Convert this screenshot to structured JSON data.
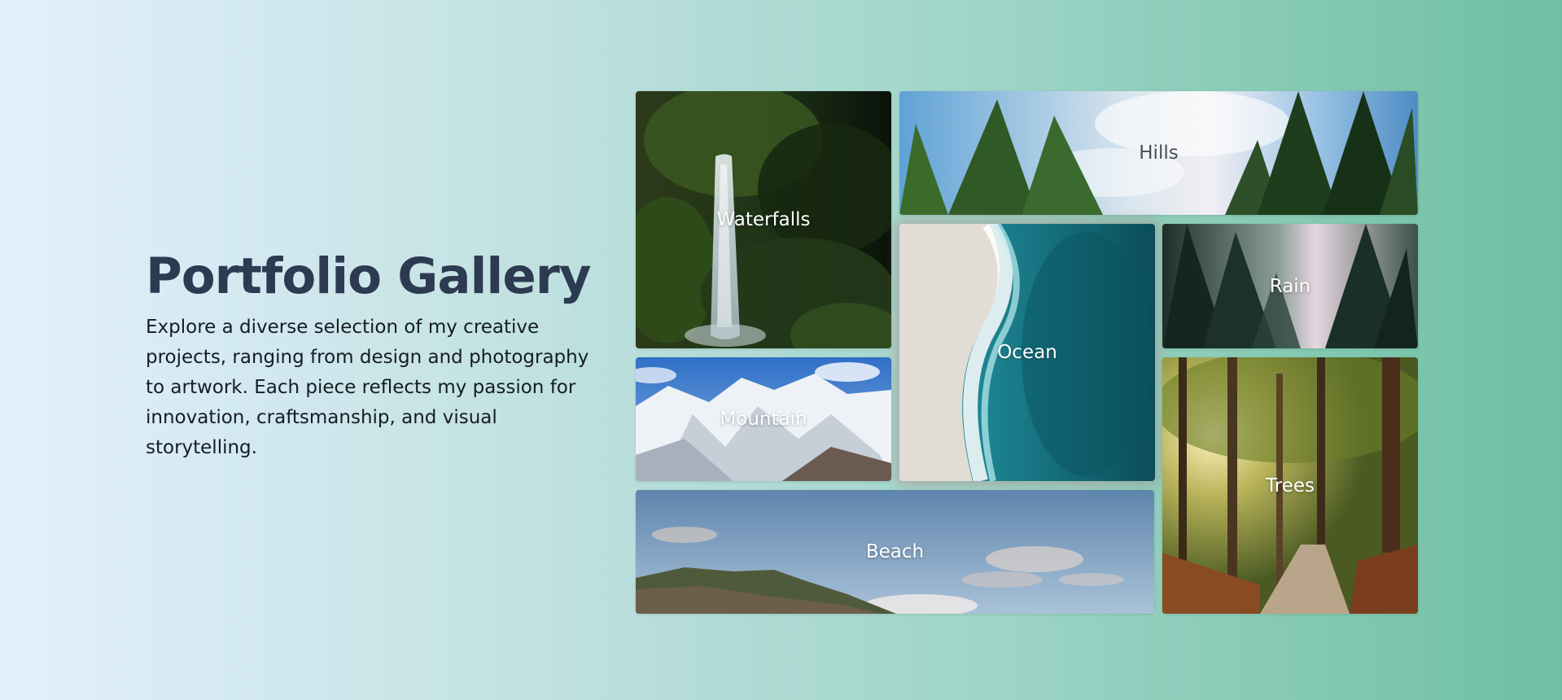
{
  "intro": {
    "title": "Portfolio Gallery",
    "description": "Explore a diverse selection of my creative projects, ranging from design and photography to artwork. Each piece reflects my passion for innovation, craftsmanship, and visual storytelling."
  },
  "gallery": {
    "items": [
      {
        "label": "Waterfalls"
      },
      {
        "label": "Hills"
      },
      {
        "label": "Ocean"
      },
      {
        "label": "Rain"
      },
      {
        "label": "Mountain"
      },
      {
        "label": "Trees"
      },
      {
        "label": "Beach"
      }
    ]
  },
  "colors": {
    "title": "#2c3b52",
    "background_start": "#e3f0fe",
    "background_end": "#6fc0a3"
  }
}
